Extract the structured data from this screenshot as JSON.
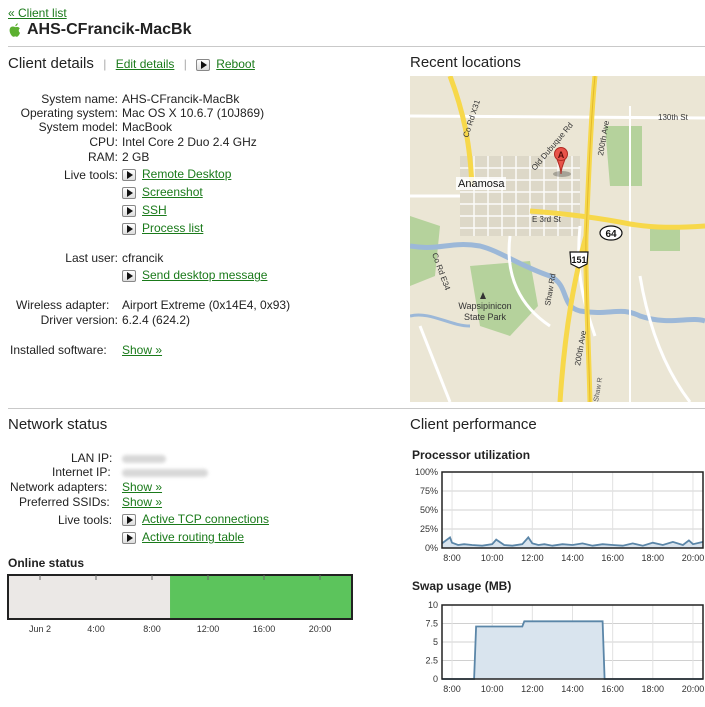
{
  "header": {
    "back_link": "« Client list",
    "client_name": "AHS-CFrancik-MacBk"
  },
  "client_details": {
    "title": "Client details",
    "edit_link": "Edit details",
    "reboot_link": "Reboot",
    "fields": {
      "system_name_label": "System name:",
      "system_name": "AHS-CFrancik-MacBk",
      "os_label": "Operating system:",
      "os": "Mac OS X 10.6.7 (10J869)",
      "model_label": "System model:",
      "model": "MacBook",
      "cpu_label": "CPU:",
      "cpu": "Intel Core 2 Duo 2.4 GHz",
      "ram_label": "RAM:",
      "ram": "2 GB",
      "live_tools_label": "Live tools:",
      "last_user_label": "Last user:",
      "last_user": "cfrancik",
      "wireless_label": "Wireless adapter:",
      "wireless": "Airport Extreme (0x14E4, 0x93)",
      "driver_label": "Driver version:",
      "driver": "6.2.4 (624.2)",
      "software_label": "Installed software:",
      "software_link": "Show »"
    },
    "live_tools": [
      "Remote Desktop",
      "Screenshot",
      "SSH",
      "Process list"
    ],
    "send_message": "Send desktop message"
  },
  "recent_locations": {
    "title": "Recent locations",
    "map_labels": {
      "road_130th": "130th St",
      "road_200th_top": "200th Ave",
      "road_old_dubuque": "Old Dubuque Rd",
      "road_co_x31": "Co Rd X31",
      "town": "Anamosa",
      "e3rd": "E 3rd St",
      "route_64": "64",
      "route_151": "151",
      "co_e34": "Co Rd E34",
      "park1": "Wapsipinicon",
      "park2": "State Park",
      "shaw": "Shaw Rd",
      "road_200th_bottom": "200th Ave",
      "shaw2": "Shaw R",
      "marker": "A"
    }
  },
  "network_status": {
    "title": "Network status",
    "lan_ip_label": "LAN IP:",
    "internet_ip_label": "Internet IP:",
    "adapters_label": "Network adapters:",
    "adapters_link": "Show »",
    "ssids_label": "Preferred SSIDs:",
    "ssids_link": "Show »",
    "live_tools_label": "Live tools:",
    "tools": [
      "Active TCP connections",
      "Active routing table"
    ]
  },
  "online_status": {
    "title": "Online status",
    "ticks": [
      "Jun 2",
      "4:00",
      "8:00",
      "12:00",
      "16:00",
      "20:00"
    ],
    "online_from_fraction": 0.471,
    "colors": {
      "offline": "#ebe8e6",
      "online": "#5cc45c"
    }
  },
  "client_performance": {
    "title": "Client performance"
  },
  "chart_data": [
    {
      "type": "area",
      "title": "Processor utilization",
      "x_ticks": [
        "8:00",
        "10:00",
        "12:00",
        "14:00",
        "16:00",
        "18:00",
        "20:00"
      ],
      "y_ticks": [
        "100%",
        "75%",
        "50%",
        "25%",
        "0%"
      ],
      "ylim": [
        0,
        100
      ],
      "xlim": [
        7.5,
        20.5
      ],
      "series": [
        {
          "x": [
            7.5,
            7.9,
            8.0,
            8.3,
            8.6,
            9.0,
            9.5,
            10.0,
            10.2,
            10.6,
            11.0,
            11.5,
            11.8,
            12.0,
            12.3,
            12.6,
            13.0,
            13.5,
            14.0,
            14.5,
            15.0,
            15.5,
            16.0,
            16.5,
            17.0,
            17.5,
            18.0,
            18.5,
            19.0,
            19.5,
            19.8,
            20.0,
            20.5
          ],
          "y": [
            6,
            14,
            7,
            4,
            5,
            4,
            3,
            5,
            11,
            4,
            3,
            5,
            14,
            6,
            4,
            5,
            3,
            5,
            4,
            6,
            3,
            5,
            4,
            3,
            6,
            3,
            7,
            4,
            8,
            4,
            10,
            5,
            8
          ]
        }
      ],
      "grid": true
    },
    {
      "type": "area",
      "title": "Swap usage (MB)",
      "x_ticks": [
        "8:00",
        "10:00",
        "12:00",
        "14:00",
        "16:00",
        "18:00",
        "20:00"
      ],
      "y_ticks": [
        "10",
        "7.5",
        "5",
        "2.5",
        "0"
      ],
      "ylim": [
        0,
        10
      ],
      "xlim": [
        7.5,
        20.5
      ],
      "series": [
        {
          "x": [
            7.5,
            9.1,
            9.2,
            11.5,
            11.6,
            15.5,
            15.6,
            20.5
          ],
          "y": [
            0,
            0,
            7.1,
            7.1,
            7.8,
            7.8,
            0,
            0
          ]
        }
      ],
      "grid": true
    }
  ]
}
